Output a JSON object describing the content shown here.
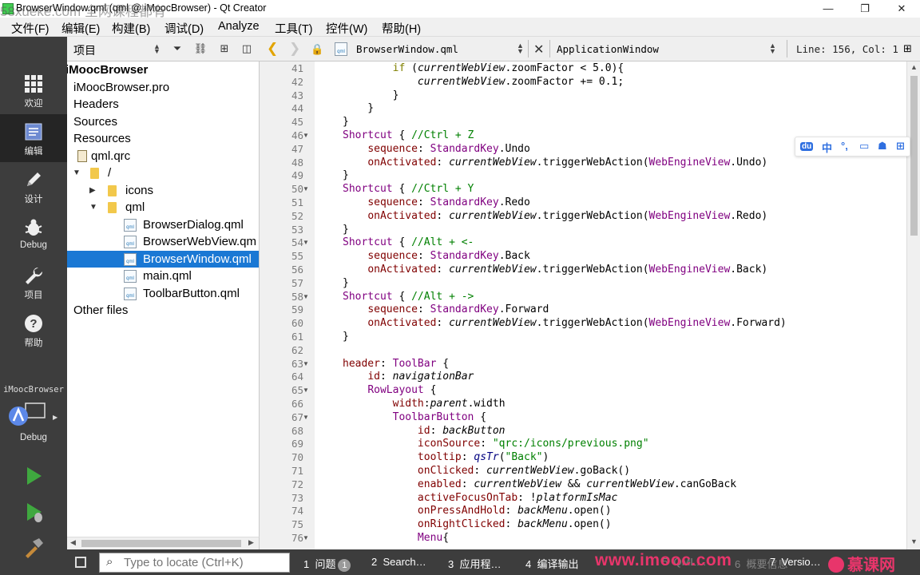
{
  "window": {
    "title": "BrowserWindow.qml (qml @ iMoocBrowser) - Qt Creator",
    "watermark": "58xueke.com 全网课程都有",
    "minimize_icon": "minimize-icon",
    "maximize_icon": "maximize-icon",
    "close_icon": "close-icon"
  },
  "menubar": {
    "items": [
      "文件(F)",
      "编辑(E)",
      "构建(B)",
      "调试(D)",
      "Analyze",
      "工具(T)",
      "控件(W)",
      "帮助(H)"
    ]
  },
  "modebar": {
    "modes": [
      {
        "label": "欢迎",
        "icon": "grid-icon"
      },
      {
        "label": "编辑",
        "icon": "document-edit-icon"
      },
      {
        "label": "设计",
        "icon": "pencil-icon"
      },
      {
        "label": "Debug",
        "icon": "bug-icon"
      },
      {
        "label": "项目",
        "icon": "wrench-icon"
      },
      {
        "label": "帮助",
        "icon": "help-icon"
      }
    ],
    "kit_project": "iMoocBrowser",
    "kit_build": "Debug"
  },
  "project_panel": {
    "title": "项目",
    "tree": [
      {
        "label": "iMoocBrowser",
        "level": 0
      },
      {
        "label": "iMoocBrowser.pro",
        "level": 0
      },
      {
        "label": "Headers",
        "level": 0
      },
      {
        "label": "Sources",
        "level": 0
      },
      {
        "label": "Resources",
        "level": 0
      },
      {
        "label": "qml.qrc",
        "level": 1
      },
      {
        "label": "/",
        "level": 1
      },
      {
        "label": "icons",
        "level": 2
      },
      {
        "label": "qml",
        "level": 2
      },
      {
        "label": "BrowserDialog.qml",
        "level": 3
      },
      {
        "label": "BrowserWebView.qm",
        "level": 3
      },
      {
        "label": "BrowserWindow.qml",
        "level": 3
      },
      {
        "label": "main.qml",
        "level": 3
      },
      {
        "label": "ToolbarButton.qml",
        "level": 3
      },
      {
        "label": "Other files",
        "level": 0
      }
    ]
  },
  "editor_toolbar": {
    "file": "BrowserWindow.qml",
    "symbol": "ApplicationWindow",
    "position": "Line: 156, Col: 1"
  },
  "editor": {
    "line_numbers": [
      "41",
      "42",
      "43",
      "44",
      "45",
      "46",
      "47",
      "48",
      "49",
      "50",
      "51",
      "52",
      "53",
      "54",
      "55",
      "56",
      "57",
      "58",
      "59",
      "60",
      "61",
      "62",
      "63",
      "64",
      "65",
      "66",
      "67",
      "68",
      "69",
      "70",
      "71",
      "72",
      "73",
      "74",
      "75",
      "76"
    ]
  },
  "ime": {
    "items": [
      "du",
      "中",
      "°,",
      "▭",
      "☗",
      "⊞"
    ]
  },
  "statusbar": {
    "locator_placeholder": "Type to locate (Ctrl+K)",
    "panes": [
      {
        "num": "1",
        "label": "问题",
        "badge": "1"
      },
      {
        "num": "2",
        "label": "Search…"
      },
      {
        "num": "3",
        "label": "应用程…"
      },
      {
        "num": "4",
        "label": "编译输出"
      },
      {
        "num": "5",
        "label": "QML…"
      },
      {
        "num": "6",
        "label": "概要信息"
      },
      {
        "num": "7",
        "label": "Versio…"
      }
    ],
    "watermark_site": "www.imooc.com",
    "watermark_brand": "慕课网"
  }
}
